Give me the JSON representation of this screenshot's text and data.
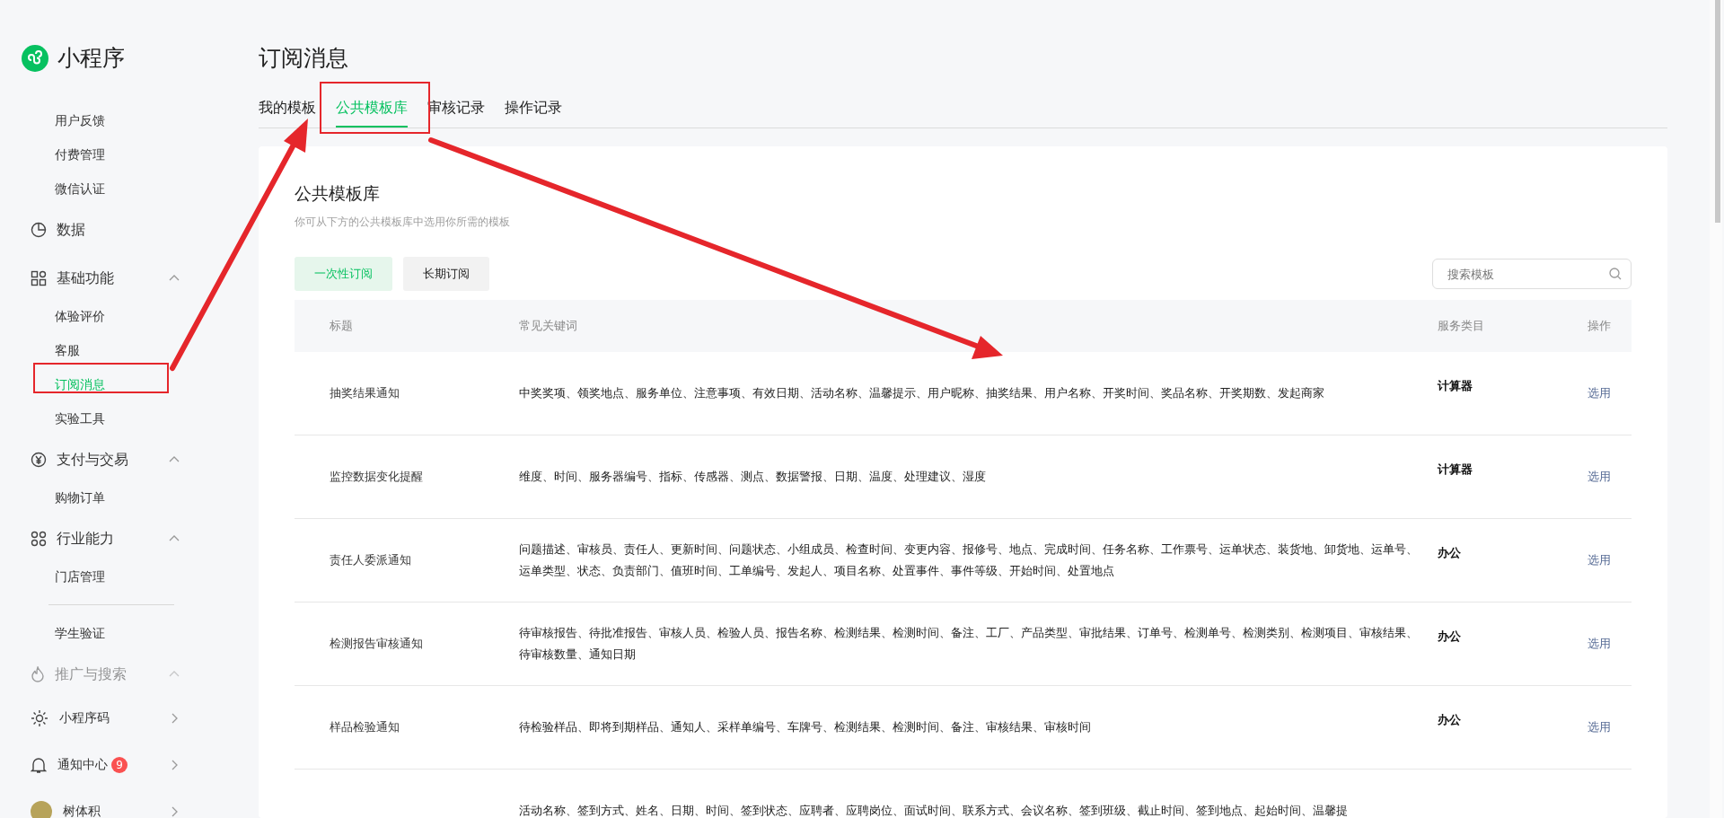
{
  "app": {
    "name": "小程序"
  },
  "sidebar": {
    "items": [
      {
        "kind": "sub",
        "label": "用户反馈",
        "selected": false
      },
      {
        "kind": "sub",
        "label": "付费管理",
        "selected": false
      },
      {
        "kind": "sub",
        "label": "微信认证",
        "selected": false
      },
      {
        "kind": "chart",
        "label": "数据"
      },
      {
        "kind": "grid",
        "label": "基础功能",
        "expanded": true
      },
      {
        "kind": "sub",
        "label": "体验评价",
        "selected": false
      },
      {
        "kind": "sub",
        "label": "客服",
        "selected": false
      },
      {
        "kind": "sub",
        "label": "订阅消息",
        "selected": true
      },
      {
        "kind": "sub",
        "label": "实验工具",
        "selected": false
      },
      {
        "kind": "yen",
        "label": "支付与交易",
        "expanded": true
      },
      {
        "kind": "sub",
        "label": "购物订单",
        "selected": false
      },
      {
        "kind": "nodes",
        "label": "行业能力",
        "expanded": true
      },
      {
        "kind": "sub",
        "label": "门店管理",
        "selected": false
      },
      {
        "kind": "sub",
        "label": "学生验证",
        "selected": false,
        "divider_before": true
      },
      {
        "kind": "flame",
        "label": "推广与搜索",
        "expanded": true,
        "faded": true
      }
    ],
    "footer": [
      {
        "kind": "code",
        "label": "小程序码"
      },
      {
        "kind": "bell",
        "label": "通知中心",
        "badge": "9"
      },
      {
        "kind": "avatar",
        "label": "树体积"
      }
    ]
  },
  "page": {
    "title": "订阅消息",
    "tabs": [
      {
        "label": "我的模板",
        "selected": false
      },
      {
        "label": "公共模板库",
        "selected": true
      },
      {
        "label": "审核记录",
        "selected": false
      },
      {
        "label": "操作记录",
        "selected": false
      }
    ]
  },
  "library": {
    "heading": "公共模板库",
    "subtitle": "你可从下方的公共模板库中选用你所需的模板",
    "filters": [
      {
        "label": "一次性订阅",
        "selected": true
      },
      {
        "label": "长期订阅",
        "selected": false
      }
    ],
    "search": {
      "placeholder": "搜索模板"
    },
    "table": {
      "columns": [
        "标题",
        "常见关键词",
        "服务类目",
        "操作"
      ],
      "rows": [
        {
          "title": "抽奖结果通知",
          "keywords": "中奖奖项、领奖地点、服务单位、注意事项、有效日期、活动名称、温馨提示、用户昵称、抽奖结果、用户名称、开奖时间、奖品名称、开奖期数、发起商家",
          "category": "计算器",
          "action": "选用"
        },
        {
          "title": "监控数据变化提醒",
          "keywords": "维度、时间、服务器编号、指标、传感器、测点、数据警报、日期、温度、处理建议、湿度",
          "category": "计算器",
          "action": "选用"
        },
        {
          "title": "责任人委派通知",
          "keywords": "问题描述、审核员、责任人、更新时间、问题状态、小组成员、检查时间、变更内容、报修号、地点、完成时间、任务名称、工作票号、运单状态、装货地、卸货地、运单号、运单类型、状态、负责部门、值班时间、工单编号、发起人、项目名称、处置事件、事件等级、开始时间、处置地点",
          "category": "办公",
          "action": "选用"
        },
        {
          "title": "检测报告审核通知",
          "keywords": "待审核报告、待批准报告、审核人员、检验人员、报告名称、检测结果、检测时间、备注、工厂、产品类型、审批结果、订单号、检测单号、检测类别、检测项目、审核结果、待审核数量、通知日期",
          "category": "办公",
          "action": "选用"
        },
        {
          "title": "样品检验通知",
          "keywords": "待检验样品、即将到期样品、通知人、采样单编号、车牌号、检测结果、检测时间、备注、审核结果、审核时间",
          "category": "办公",
          "action": "选用"
        },
        {
          "keywords": "活动名称、签到方式、姓名、日期、时间、签到状态、应聘者、应聘岗位、面试时间、联系方式、会议名称、签到班级、截止时间、签到地点、起始时间、温馨提"
        }
      ]
    }
  }
}
